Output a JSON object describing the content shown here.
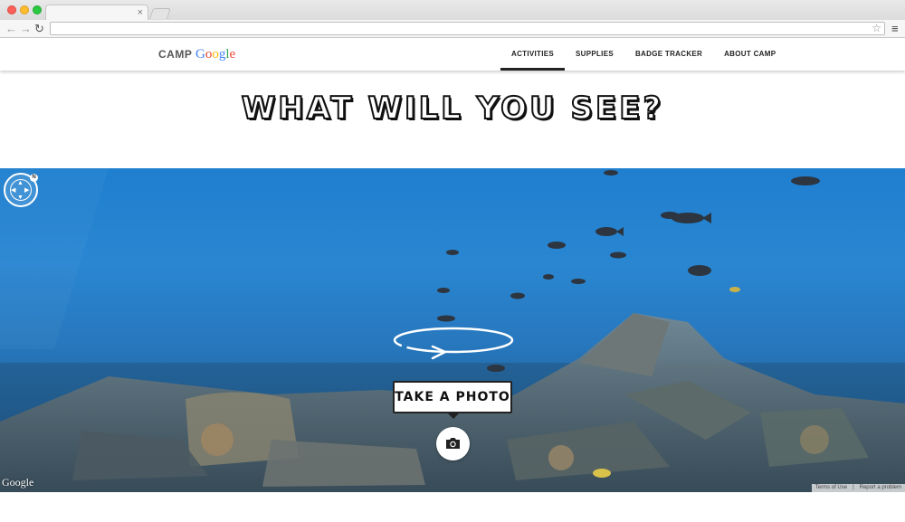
{
  "browser": {
    "tab_close": "×",
    "back_icon": "arrow-left-icon",
    "forward_icon": "arrow-right-icon",
    "reload_icon": "reload-icon",
    "star_icon": "star-icon",
    "menu_icon": "hamburger-menu-icon"
  },
  "site": {
    "logo_prefix": "CAMP",
    "logo_brand": [
      "G",
      "o",
      "o",
      "g",
      "l",
      "e"
    ],
    "nav": [
      {
        "label": "ACTIVITIES",
        "active": true
      },
      {
        "label": "SUPPLIES",
        "active": false
      },
      {
        "label": "BADGE TRACKER",
        "active": false
      },
      {
        "label": "ABOUT CAMP",
        "active": false
      }
    ]
  },
  "hero": {
    "title": "WHAT WILL YOU SEE?"
  },
  "panorama": {
    "compass_north": "N",
    "take_photo_label": "TAKE A PHOTO",
    "brand": "Google",
    "footer": {
      "terms": "Terms of Use",
      "report": "Report a problem"
    }
  },
  "colors": {
    "water_top": "#1f7fcf",
    "water_bottom": "#19456f",
    "text_dark": "#111111"
  }
}
